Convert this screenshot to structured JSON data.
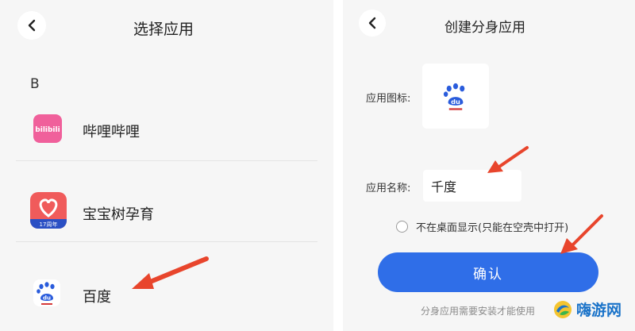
{
  "left": {
    "title": "选择应用",
    "section": "B",
    "apps": [
      {
        "name": "哔哩哔哩",
        "icon_label": "bilibili"
      },
      {
        "name": "宝宝树孕育",
        "icon_label": "17周年"
      },
      {
        "name": "百度",
        "icon_label": "du"
      }
    ]
  },
  "right": {
    "title": "创建分身应用",
    "icon_label": "应用图标:",
    "name_label": "应用名称:",
    "name_value": "千度",
    "icon_text": "du",
    "checkbox_label": "不在桌面显示(只能在空壳中打开)",
    "confirm_label": "确认",
    "footer": "分身应用需要安装才能使用"
  },
  "watermark": {
    "text": "嗨游网"
  },
  "colors": {
    "accent": "#2f6ee8",
    "arrow": "#e8452c",
    "bilibili": "#f0609b",
    "babytree": "#f05b5b",
    "baidu": "#2a5cdc"
  }
}
